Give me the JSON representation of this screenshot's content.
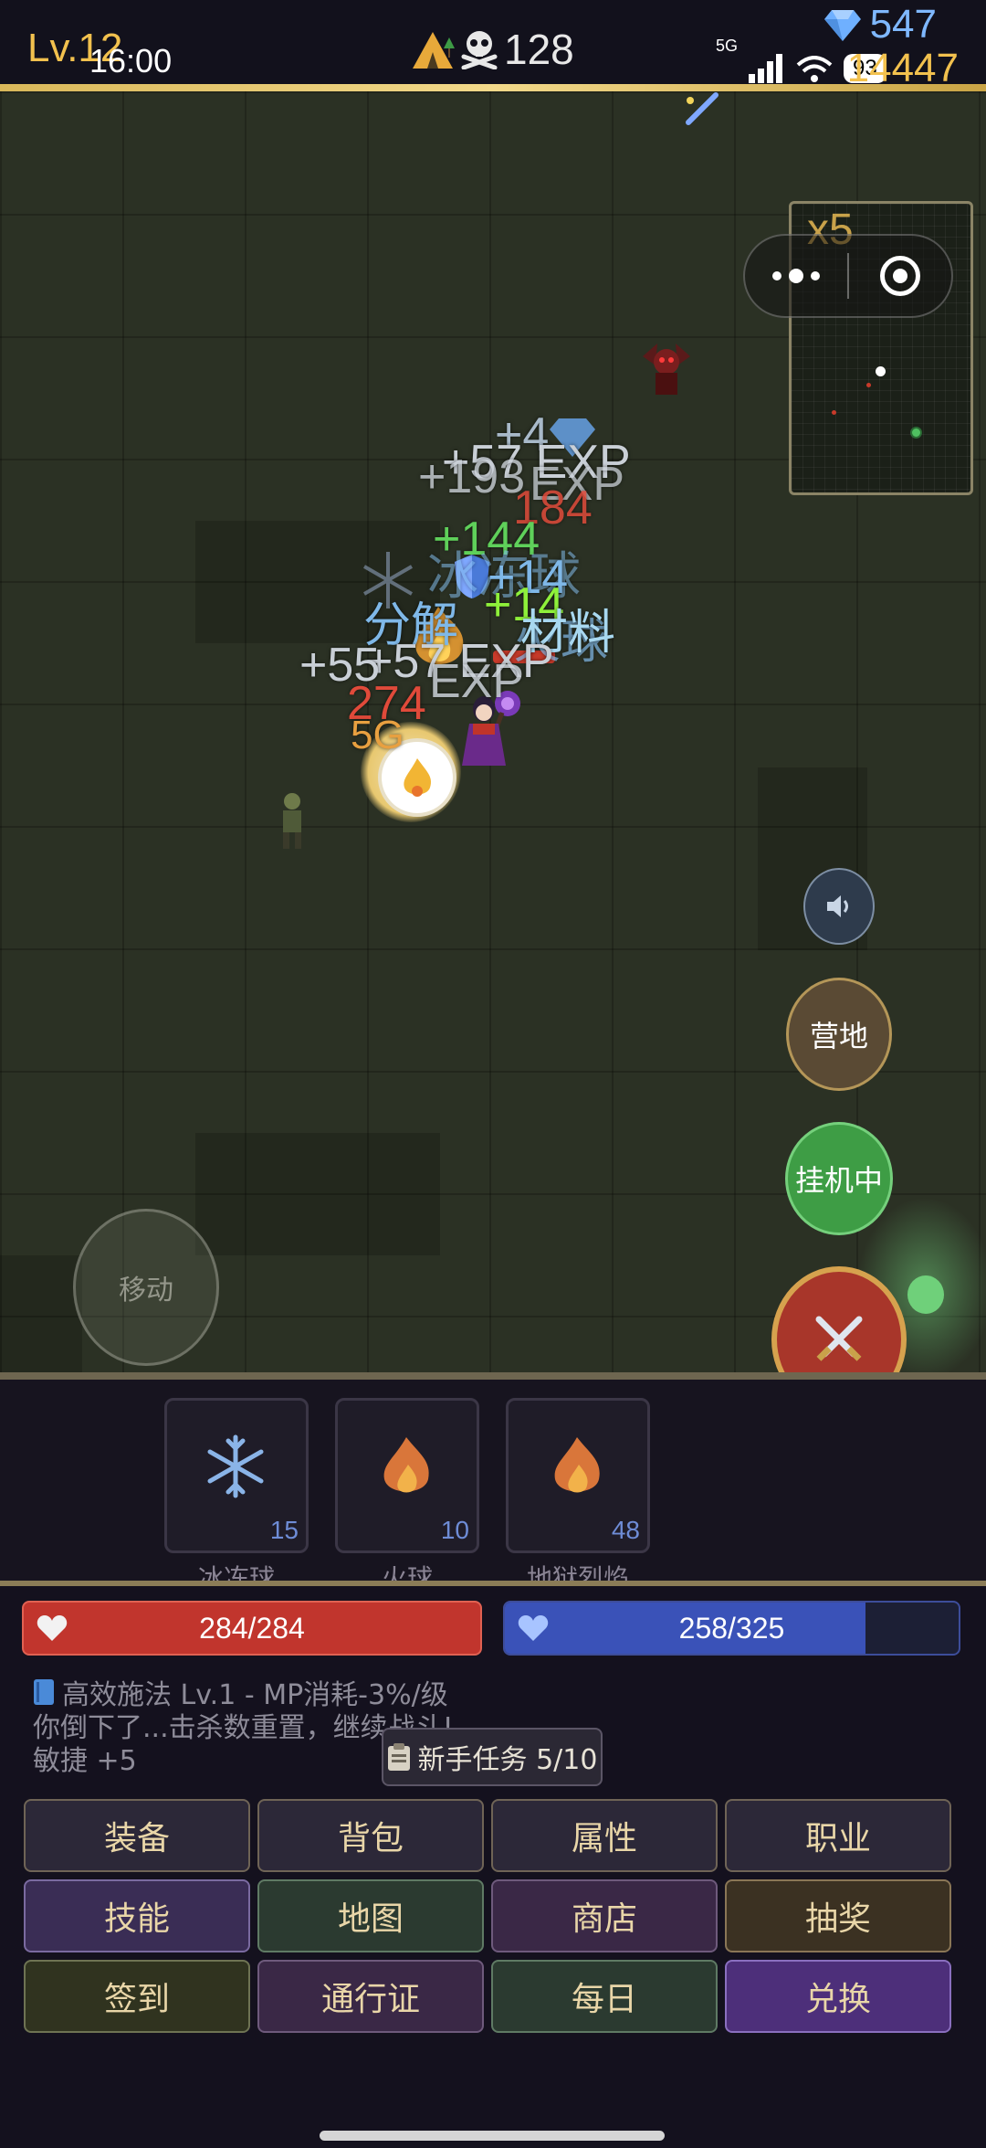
{
  "hud": {
    "level": "Lv.12",
    "clock": "16:00",
    "kills": "128",
    "gems": "547",
    "gold": "14447",
    "network": "5G",
    "battery": "93"
  },
  "field": {
    "minimap_zoom": "x5",
    "move_label": "移动",
    "camp_label": "营地",
    "idle_label": "挂机中",
    "floating_texts": [
      {
        "text": "+4",
        "color": "#a8b9c9"
      },
      {
        "text": "+57 EXP",
        "color": "#c9cfd6"
      },
      {
        "text": "+193",
        "color": "#c9cfd6"
      },
      {
        "text": "EXP",
        "color": "#c9cfd6"
      },
      {
        "text": "184",
        "color": "#e04a3a"
      },
      {
        "text": "+144",
        "color": "#5fd05a"
      },
      {
        "text": "冰冻球",
        "color": "#7fb8e8"
      },
      {
        "text": "+14",
        "color": "#7fb8e8"
      },
      {
        "text": "+14",
        "color": "#8ef03a"
      },
      {
        "text": "火球",
        "color": "#7fb8e8"
      },
      {
        "text": "分解",
        "color": "#7fb8e8"
      },
      {
        "text": "材料",
        "color": "#a8d8f0"
      },
      {
        "text": "+57 EXP",
        "color": "#c9cfd6"
      },
      {
        "text": "+55",
        "color": "#c9cfd6"
      },
      {
        "text": "EXP",
        "color": "#c9cfd6"
      },
      {
        "text": "274",
        "color": "#e04a3a"
      },
      {
        "text": "5G",
        "color": "#e8a040"
      }
    ]
  },
  "skills": [
    {
      "name": "冰冻球",
      "count": "15",
      "icon": "snowflake-icon"
    },
    {
      "name": "火球",
      "count": "10",
      "icon": "fire-icon"
    },
    {
      "name": "地狱烈焰",
      "count": "48",
      "icon": "fire-icon"
    }
  ],
  "status": {
    "hp": {
      "current": 284,
      "max": 284,
      "label": "284/284",
      "color": "#c1352d"
    },
    "mp": {
      "current": 258,
      "max": 325,
      "label": "258/325",
      "color": "#3a52b8"
    }
  },
  "log": [
    "高效施法 Lv.1 - MP消耗-3%/级",
    "你倒下了...击杀数重置，继续战斗!",
    "敏捷 +5"
  ],
  "quest": {
    "label": "新手任务 5/10"
  },
  "menu": [
    {
      "label": "装备",
      "style": "c-gray"
    },
    {
      "label": "背包",
      "style": "c-gray"
    },
    {
      "label": "属性",
      "style": "c-gray"
    },
    {
      "label": "职业",
      "style": "c-gray"
    },
    {
      "label": "技能",
      "style": "c-purple"
    },
    {
      "label": "地图",
      "style": "c-green"
    },
    {
      "label": "商店",
      "style": "c-plum"
    },
    {
      "label": "抽奖",
      "style": "c-brown"
    },
    {
      "label": "签到",
      "style": "c-olive"
    },
    {
      "label": "通行证",
      "style": "c-plum"
    },
    {
      "label": "每日",
      "style": "c-green"
    },
    {
      "label": "兑换",
      "style": "c-violet"
    }
  ]
}
